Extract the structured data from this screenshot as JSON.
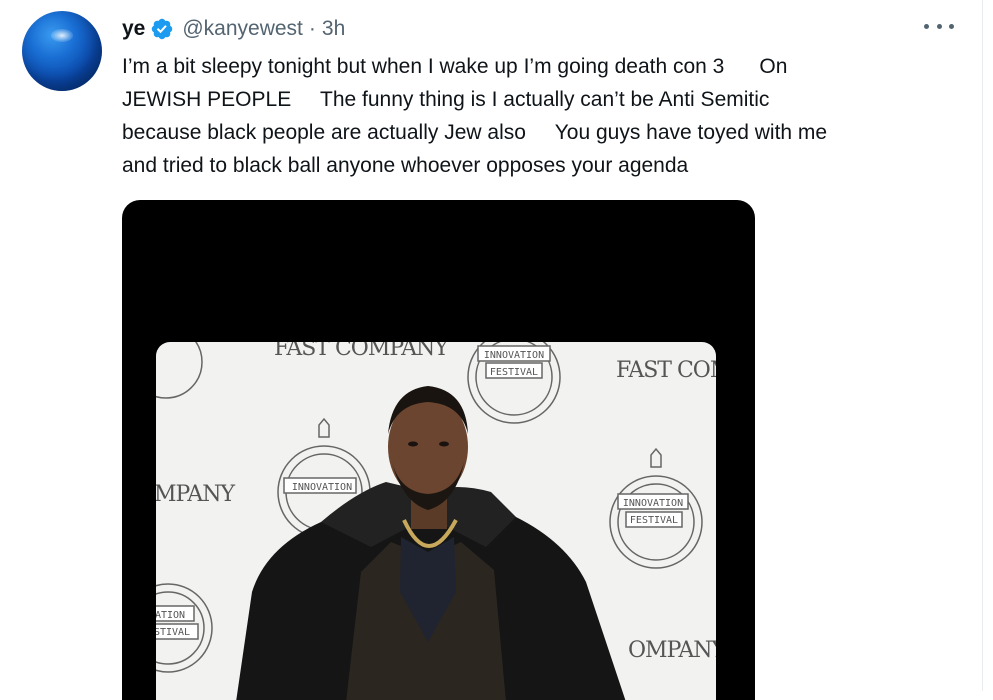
{
  "tweet": {
    "display_name": "ye",
    "handle": "@kanyewest",
    "separator": "·",
    "timestamp": "3h",
    "text_lines": [
      "I’m a bit sleepy tonight but when I wake up I’m going death con 3      On",
      "JEWISH PEOPLE     The funny thing is I actually can’t be Anti Semitic",
      "because black people are actually Jew also     You guys have toyed with me",
      "and tried to black ball anyone whoever opposes your agenda"
    ]
  },
  "media": {
    "backdrop_logos": {
      "fast_company_1": "FAST COMPANY",
      "fast_company_2": "FAST COMP",
      "company_left": "MPANY",
      "company_right": "OMPANY",
      "festival_top_line1": "INNOVATION",
      "festival_top_line2": "FESTIVAL",
      "festival_mid_line1": "INNOVATION",
      "festival_right_line1": "INNOVATION",
      "festival_right_line2": "FESTIVAL",
      "festival_left_line1": "ATION",
      "festival_left_line2": "STIVAL"
    }
  },
  "colors": {
    "verified_badge": "#1d9bf0",
    "secondary_text": "#536471",
    "primary_text": "#0f1419"
  },
  "icons": {
    "verified": "verified-badge-icon",
    "more": "more-horizontal-icon"
  }
}
